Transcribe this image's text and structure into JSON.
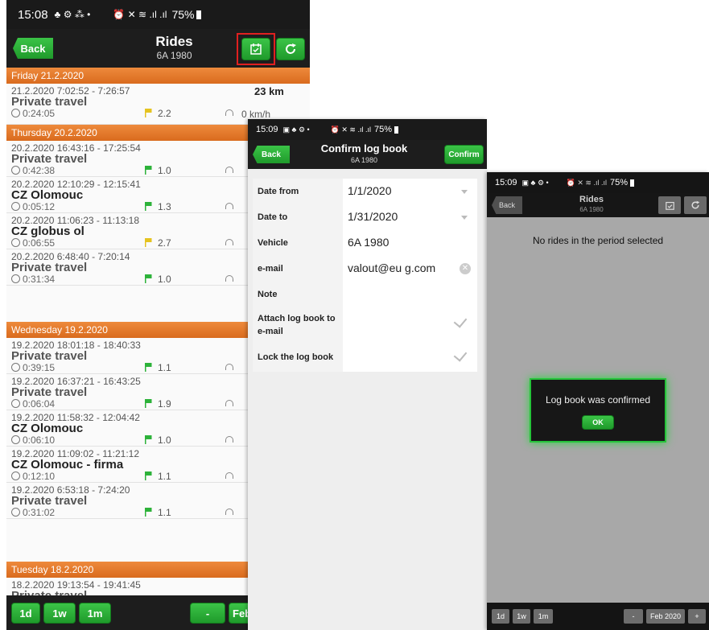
{
  "colors": {
    "accent_green": "#2db23a",
    "day_header_orange": "#e57a28",
    "highlight_red": "#e02020",
    "app_bar": "#1d1d1d"
  },
  "panel1": {
    "status": {
      "time": "15:08",
      "icons": "♣ ⚙ ⁂ •",
      "right_icons": "⏰ ✕ ≋ .ıl .ıl",
      "battery": "75%"
    },
    "header": {
      "back_label": "Back",
      "title": "Rides",
      "subtitle": "6A 1980",
      "calendar_icon": "calendar-check-icon",
      "refresh_icon": "refresh-icon"
    },
    "days": [
      {
        "label": "Friday 21.2.2020"
      },
      {
        "label": "Thursday 20.2.2020"
      },
      {
        "label": "Wednesday 19.2.2020"
      },
      {
        "label": "Tuesday 18.2.2020"
      }
    ],
    "rides": [
      {
        "time": "21.2.2020 7:02:52 - 7:26:57",
        "title": "Private travel",
        "duration": "0:24:05",
        "value": "2.2",
        "distance": "23 km",
        "speed": "0 km/h"
      },
      {
        "time": "20.2.2020 16:43:16 - 17:25:54",
        "title": "Private travel",
        "duration": "0:42:38",
        "value": "1.0"
      },
      {
        "time": "20.2.2020 12:10:29 - 12:15:41",
        "title": "CZ Olomouc",
        "duration": "0:05:12",
        "value": "1.3"
      },
      {
        "time": "20.2.2020 11:06:23 - 11:13:18",
        "title": "CZ globus ol",
        "duration": "0:06:55",
        "value": "2.7"
      },
      {
        "time": "20.2.2020 6:48:40 - 7:20:14",
        "title": "Private travel",
        "duration": "0:31:34",
        "value": "1.0"
      },
      {
        "time": "19.2.2020 18:01:18 - 18:40:33",
        "title": "Private travel",
        "duration": "0:39:15",
        "value": "1.1"
      },
      {
        "time": "19.2.2020 16:37:21 - 16:43:25",
        "title": "Private travel",
        "duration": "0:06:04",
        "value": "1.9"
      },
      {
        "time": "19.2.2020 11:58:32 - 12:04:42",
        "title": "CZ Olomouc",
        "duration": "0:06:10",
        "value": "1.0"
      },
      {
        "time": "19.2.2020 11:09:02 - 11:21:12",
        "title": "CZ Olomouc - firma",
        "duration": "0:12:10",
        "value": "1.1"
      },
      {
        "time": "19.2.2020 6:53:18 - 7:24:20",
        "title": "Private travel",
        "duration": "0:31:02",
        "value": "1.1"
      },
      {
        "time": "18.2.2020 19:13:54 - 19:41:45",
        "title": "Private travel"
      }
    ],
    "bottom": {
      "d1": "1d",
      "w1": "1w",
      "m1": "1m",
      "minus": "-",
      "period": "Feb"
    }
  },
  "panel2": {
    "status": {
      "time": "15:09",
      "icons": "▣ ♣ ⚙ •",
      "right_icons": "⏰ ✕ ≋ .ıl .ıl",
      "battery": "75%"
    },
    "header": {
      "back_label": "Back",
      "title": "Confirm log book",
      "subtitle": "6A 1980",
      "confirm_label": "Confirm"
    },
    "form": {
      "date_from_label": "Date from",
      "date_from_value": "1/1/2020",
      "date_to_label": "Date to",
      "date_to_value": "1/31/2020",
      "vehicle_label": "Vehicle",
      "vehicle_value": "6A 1980",
      "email_label": "e-mail",
      "email_value": "valout@eu     g.com",
      "note_label": "Note",
      "attach_label": "Attach log book to e-mail",
      "lock_label": "Lock the log book"
    }
  },
  "panel3": {
    "status": {
      "time": "15:09",
      "icons": "▣ ♣ ⚙ •",
      "right_icons": "⏰ ✕ ≋ .ıl .ıl",
      "battery": "75%"
    },
    "header": {
      "back_label": "Back",
      "title": "Rides",
      "subtitle": "6A 1980"
    },
    "empty_message": "No rides in the period selected",
    "dialog": {
      "message": "Log book was confirmed",
      "ok_label": "OK"
    },
    "bottom": {
      "d1": "1d",
      "w1": "1w",
      "m1": "1m",
      "minus": "-",
      "period": "Feb 2020",
      "plus": "+"
    }
  }
}
